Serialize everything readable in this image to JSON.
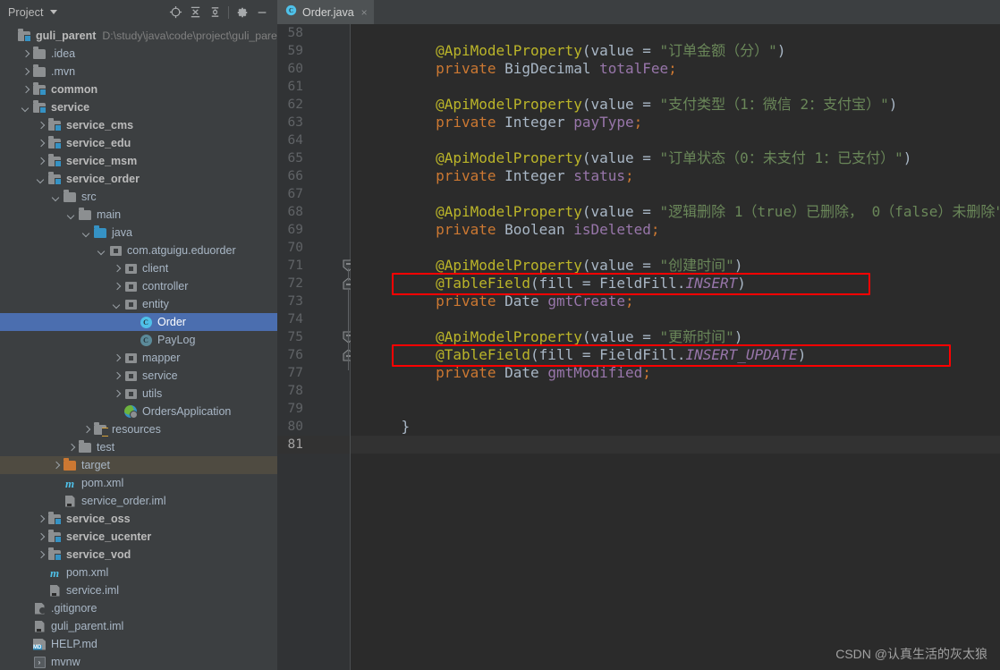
{
  "window": {
    "accent_selection": "#4b6eaf",
    "excluded_highlight": "#4f4b41",
    "editor_background": "#2b2b2b",
    "panel_background": "#3c3f41"
  },
  "project_panel": {
    "title": "Project",
    "toolbar": [
      {
        "name": "locate-icon",
        "label": "Select Opened File"
      },
      {
        "name": "expand-all-icon",
        "label": "Expand All"
      },
      {
        "name": "collapse-all-icon",
        "label": "Collapse All"
      },
      {
        "name": "gear-icon",
        "label": "Settings"
      },
      {
        "name": "minimize-icon",
        "label": "Hide"
      }
    ],
    "tree": [
      {
        "label": "guli_parent",
        "path": "D:\\study\\java\\code\\project\\guli_pare",
        "indent": 0,
        "arrow": "none",
        "icon": "module-folder",
        "style": "bold",
        "state": "normal"
      },
      {
        "label": ".idea",
        "indent": 1,
        "arrow": "right",
        "icon": "folder",
        "state": "normal"
      },
      {
        "label": ".mvn",
        "indent": 1,
        "arrow": "right",
        "icon": "folder",
        "state": "normal"
      },
      {
        "label": "common",
        "indent": 1,
        "arrow": "right",
        "icon": "module-folder",
        "style": "bold",
        "state": "normal"
      },
      {
        "label": "service",
        "indent": 1,
        "arrow": "down",
        "icon": "module-folder",
        "style": "bold",
        "state": "normal"
      },
      {
        "label": "service_cms",
        "indent": 2,
        "arrow": "right",
        "icon": "module-folder",
        "style": "bold",
        "state": "normal"
      },
      {
        "label": "service_edu",
        "indent": 2,
        "arrow": "right",
        "icon": "module-folder",
        "style": "bold",
        "state": "normal"
      },
      {
        "label": "service_msm",
        "indent": 2,
        "arrow": "right",
        "icon": "module-folder",
        "style": "bold",
        "state": "normal"
      },
      {
        "label": "service_order",
        "indent": 2,
        "arrow": "down",
        "icon": "module-folder",
        "style": "bold",
        "state": "normal"
      },
      {
        "label": "src",
        "indent": 3,
        "arrow": "down",
        "icon": "folder",
        "state": "normal"
      },
      {
        "label": "main",
        "indent": 4,
        "arrow": "down",
        "icon": "folder",
        "state": "normal"
      },
      {
        "label": "java",
        "indent": 5,
        "arrow": "down",
        "icon": "source-folder",
        "state": "normal"
      },
      {
        "label": "com.atguigu.eduorder",
        "indent": 6,
        "arrow": "down",
        "icon": "package",
        "state": "normal"
      },
      {
        "label": "client",
        "indent": 7,
        "arrow": "right",
        "icon": "package",
        "state": "normal"
      },
      {
        "label": "controller",
        "indent": 7,
        "arrow": "right",
        "icon": "package",
        "state": "normal"
      },
      {
        "label": "entity",
        "indent": 7,
        "arrow": "down",
        "icon": "package",
        "state": "normal"
      },
      {
        "label": "Order",
        "indent": 8,
        "arrow": "none",
        "icon": "java-class",
        "state": "selected"
      },
      {
        "label": "PayLog",
        "indent": 8,
        "arrow": "none",
        "icon": "java-class-dim",
        "state": "normal"
      },
      {
        "label": "mapper",
        "indent": 7,
        "arrow": "right",
        "icon": "package",
        "state": "normal"
      },
      {
        "label": "service",
        "indent": 7,
        "arrow": "right",
        "icon": "package",
        "state": "normal"
      },
      {
        "label": "utils",
        "indent": 7,
        "arrow": "right",
        "icon": "package",
        "state": "normal"
      },
      {
        "label": "OrdersApplication",
        "indent": 7,
        "arrow": "none",
        "icon": "spring-class",
        "state": "normal"
      },
      {
        "label": "resources",
        "indent": 5,
        "arrow": "right",
        "icon": "resources-folder",
        "state": "normal"
      },
      {
        "label": "test",
        "indent": 4,
        "arrow": "right",
        "icon": "folder",
        "state": "normal"
      },
      {
        "label": "target",
        "indent": 3,
        "arrow": "right",
        "icon": "target-folder",
        "state": "excluded"
      },
      {
        "label": "pom.xml",
        "indent": 3,
        "arrow": "none",
        "icon": "maven-file",
        "state": "normal"
      },
      {
        "label": "service_order.iml",
        "indent": 3,
        "arrow": "none",
        "icon": "iml-file",
        "state": "normal"
      },
      {
        "label": "service_oss",
        "indent": 2,
        "arrow": "right",
        "icon": "module-folder",
        "style": "bold",
        "state": "normal"
      },
      {
        "label": "service_ucenter",
        "indent": 2,
        "arrow": "right",
        "icon": "module-folder",
        "style": "bold",
        "state": "normal"
      },
      {
        "label": "service_vod",
        "indent": 2,
        "arrow": "right",
        "icon": "module-folder",
        "style": "bold",
        "state": "normal"
      },
      {
        "label": "pom.xml",
        "indent": 2,
        "arrow": "none",
        "icon": "maven-file",
        "state": "normal"
      },
      {
        "label": "service.iml",
        "indent": 2,
        "arrow": "none",
        "icon": "iml-file",
        "state": "normal"
      },
      {
        "label": ".gitignore",
        "indent": 1,
        "arrow": "none",
        "icon": "gitignore-file",
        "state": "normal"
      },
      {
        "label": "guli_parent.iml",
        "indent": 1,
        "arrow": "none",
        "icon": "iml-file",
        "state": "normal"
      },
      {
        "label": "HELP.md",
        "indent": 1,
        "arrow": "none",
        "icon": "markdown-file",
        "state": "normal"
      },
      {
        "label": "mvnw",
        "indent": 1,
        "arrow": "none",
        "icon": "shell-file",
        "state": "normal"
      }
    ]
  },
  "editor": {
    "tabs": [
      {
        "name": "Order.java",
        "icon": "java-class-icon",
        "close": "×",
        "active": true
      }
    ],
    "first_line_number": 58,
    "current_line": 81,
    "lines": [
      {
        "n": 58,
        "tokens": []
      },
      {
        "n": 59,
        "tokens": [
          {
            "t": "@ApiModelProperty",
            "c": "ann"
          },
          {
            "t": "(",
            "c": "op"
          },
          {
            "t": "value",
            "c": "pln"
          },
          {
            "t": " = ",
            "c": "op"
          },
          {
            "t": "\"订单金额（分）\"",
            "c": "str"
          },
          {
            "t": ")",
            "c": "op"
          }
        ]
      },
      {
        "n": 60,
        "tokens": [
          {
            "t": "private",
            "c": "kw"
          },
          {
            "t": " ",
            "c": "pln"
          },
          {
            "t": "BigDecimal",
            "c": "typ"
          },
          {
            "t": " ",
            "c": "pln"
          },
          {
            "t": "totalFee",
            "c": "fld"
          },
          {
            "t": ";",
            "c": "kw"
          }
        ]
      },
      {
        "n": 61,
        "tokens": []
      },
      {
        "n": 62,
        "tokens": [
          {
            "t": "@ApiModelProperty",
            "c": "ann"
          },
          {
            "t": "(",
            "c": "op"
          },
          {
            "t": "value",
            "c": "pln"
          },
          {
            "t": " = ",
            "c": "op"
          },
          {
            "t": "\"支付类型（1：微信 2：支付宝）\"",
            "c": "str"
          },
          {
            "t": ")",
            "c": "op"
          }
        ]
      },
      {
        "n": 63,
        "tokens": [
          {
            "t": "private",
            "c": "kw"
          },
          {
            "t": " ",
            "c": "pln"
          },
          {
            "t": "Integer",
            "c": "typ"
          },
          {
            "t": " ",
            "c": "pln"
          },
          {
            "t": "payType",
            "c": "fld"
          },
          {
            "t": ";",
            "c": "kw"
          }
        ]
      },
      {
        "n": 64,
        "tokens": []
      },
      {
        "n": 65,
        "tokens": [
          {
            "t": "@ApiModelProperty",
            "c": "ann"
          },
          {
            "t": "(",
            "c": "op"
          },
          {
            "t": "value",
            "c": "pln"
          },
          {
            "t": " = ",
            "c": "op"
          },
          {
            "t": "\"订单状态（0：未支付 1：已支付）\"",
            "c": "str"
          },
          {
            "t": ")",
            "c": "op"
          }
        ]
      },
      {
        "n": 66,
        "tokens": [
          {
            "t": "private",
            "c": "kw"
          },
          {
            "t": " ",
            "c": "pln"
          },
          {
            "t": "Integer",
            "c": "typ"
          },
          {
            "t": " ",
            "c": "pln"
          },
          {
            "t": "status",
            "c": "fld"
          },
          {
            "t": ";",
            "c": "kw"
          }
        ]
      },
      {
        "n": 67,
        "tokens": []
      },
      {
        "n": 68,
        "tokens": [
          {
            "t": "@ApiModelProperty",
            "c": "ann"
          },
          {
            "t": "(",
            "c": "op"
          },
          {
            "t": "value",
            "c": "pln"
          },
          {
            "t": " = ",
            "c": "op"
          },
          {
            "t": "\"逻辑删除 1（true）已删除， 0（false）未删除\"",
            "c": "str"
          },
          {
            "t": ")",
            "c": "op"
          }
        ]
      },
      {
        "n": 69,
        "tokens": [
          {
            "t": "private",
            "c": "kw"
          },
          {
            "t": " ",
            "c": "pln"
          },
          {
            "t": "Boolean",
            "c": "typ"
          },
          {
            "t": " ",
            "c": "pln"
          },
          {
            "t": "isDeleted",
            "c": "fld"
          },
          {
            "t": ";",
            "c": "kw"
          }
        ]
      },
      {
        "n": 70,
        "tokens": []
      },
      {
        "n": 71,
        "tokens": [
          {
            "t": "@ApiModelProperty",
            "c": "ann"
          },
          {
            "t": "(",
            "c": "op"
          },
          {
            "t": "value",
            "c": "pln"
          },
          {
            "t": " = ",
            "c": "op"
          },
          {
            "t": "\"创建时间\"",
            "c": "str"
          },
          {
            "t": ")",
            "c": "op"
          }
        ]
      },
      {
        "n": 72,
        "tokens": [
          {
            "t": "@TableField",
            "c": "ann"
          },
          {
            "t": "(",
            "c": "op"
          },
          {
            "t": "fill",
            "c": "pln"
          },
          {
            "t": " = ",
            "c": "op"
          },
          {
            "t": "FieldFill",
            "c": "typ"
          },
          {
            "t": ".",
            "c": "op"
          },
          {
            "t": "INSERT",
            "c": "fldi"
          },
          {
            "t": ")",
            "c": "op"
          }
        ]
      },
      {
        "n": 73,
        "tokens": [
          {
            "t": "private",
            "c": "kw"
          },
          {
            "t": " ",
            "c": "pln"
          },
          {
            "t": "Date",
            "c": "typ"
          },
          {
            "t": " ",
            "c": "pln"
          },
          {
            "t": "gmtCreate",
            "c": "fld"
          },
          {
            "t": ";",
            "c": "kw"
          }
        ]
      },
      {
        "n": 74,
        "tokens": []
      },
      {
        "n": 75,
        "tokens": [
          {
            "t": "@ApiModelProperty",
            "c": "ann"
          },
          {
            "t": "(",
            "c": "op"
          },
          {
            "t": "value",
            "c": "pln"
          },
          {
            "t": " = ",
            "c": "op"
          },
          {
            "t": "\"更新时间\"",
            "c": "str"
          },
          {
            "t": ")",
            "c": "op"
          }
        ]
      },
      {
        "n": 76,
        "tokens": [
          {
            "t": "@TableField",
            "c": "ann"
          },
          {
            "t": "(",
            "c": "op"
          },
          {
            "t": "fill",
            "c": "pln"
          },
          {
            "t": " = ",
            "c": "op"
          },
          {
            "t": "FieldFill",
            "c": "typ"
          },
          {
            "t": ".",
            "c": "op"
          },
          {
            "t": "INSERT_UPDATE",
            "c": "fldi"
          },
          {
            "t": ")",
            "c": "op"
          }
        ]
      },
      {
        "n": 77,
        "tokens": [
          {
            "t": "private",
            "c": "kw"
          },
          {
            "t": " ",
            "c": "pln"
          },
          {
            "t": "Date",
            "c": "typ"
          },
          {
            "t": " ",
            "c": "pln"
          },
          {
            "t": "gmtModified",
            "c": "fld"
          },
          {
            "t": ";",
            "c": "kw"
          }
        ]
      },
      {
        "n": 78,
        "tokens": []
      },
      {
        "n": 79,
        "tokens": []
      },
      {
        "n": 80,
        "tokens": [
          {
            "t": "}",
            "c": "typ"
          }
        ],
        "indent": 0
      },
      {
        "n": 81,
        "tokens": []
      }
    ],
    "fold_markers": [
      {
        "line": 71,
        "type": "start"
      },
      {
        "line": 72,
        "type": "end"
      },
      {
        "line": 75,
        "type": "start"
      },
      {
        "line": 76,
        "type": "end"
      }
    ],
    "annotations": [
      {
        "name": "red-highlight-box",
        "line": 72,
        "color": "#ff0000"
      },
      {
        "name": "red-highlight-box",
        "line": 76,
        "color": "#ff0000"
      }
    ]
  },
  "watermark": {
    "text": "CSDN @认真生活的灰太狼"
  }
}
